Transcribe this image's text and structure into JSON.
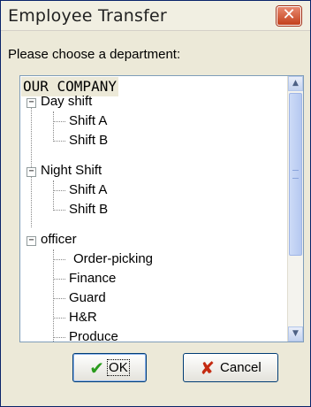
{
  "window": {
    "title": "Employee Transfer",
    "close_label": "✕"
  },
  "prompt": "Please choose a department:",
  "tree": {
    "root": "OUR COMPANY",
    "groups": [
      {
        "label": "Day shift",
        "expander": "−",
        "children": [
          "Shift A",
          "Shift B"
        ]
      },
      {
        "label": "Night Shift",
        "expander": "−",
        "children": [
          "Shift A",
          "Shift B"
        ]
      },
      {
        "label": "officer",
        "expander": "−",
        "children": [
          "Order-picking",
          "Finance",
          "Guard",
          "H&R",
          "Produce"
        ]
      }
    ]
  },
  "scrollbar": {
    "up_arrow": "▲",
    "down_arrow": "▼",
    "up_icon": "arrow-up-icon",
    "down_icon": "arrow-down-icon"
  },
  "buttons": {
    "ok": {
      "label": "OK",
      "icon": "✔",
      "icon_name": "check-icon"
    },
    "cancel": {
      "label": "Cancel",
      "icon": "✘",
      "icon_name": "x-icon"
    }
  }
}
